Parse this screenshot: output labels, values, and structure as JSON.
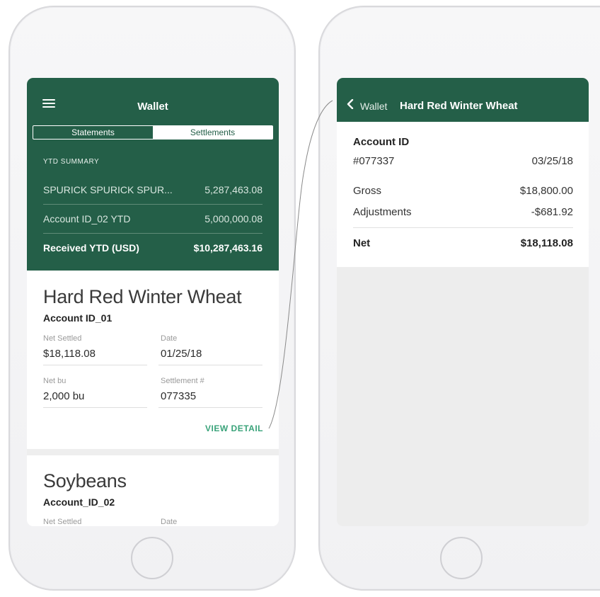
{
  "left_screen": {
    "header": {
      "title": "Wallet",
      "tabs": [
        {
          "label": "Statements",
          "active": false
        },
        {
          "label": "Settlements",
          "active": true
        }
      ]
    },
    "ytd_summary": {
      "label": "YTD SUMMARY",
      "rows": [
        {
          "label": "SPURICK SPURICK SPUR...",
          "value": "5,287,463.08"
        },
        {
          "label": "Account ID_02 YTD",
          "value": "5,000,000.08"
        }
      ],
      "total": {
        "label": "Received YTD (USD)",
        "value": "$10,287,463.16"
      }
    },
    "cards": [
      {
        "title": "Hard Red Winter Wheat",
        "account": "Account ID_01",
        "fields": [
          {
            "label": "Net Settled",
            "value": "$18,118.08"
          },
          {
            "label": "Date",
            "value": "01/25/18"
          },
          {
            "label": "Net bu",
            "value": "2,000 bu"
          },
          {
            "label": "Settlement #",
            "value": "077335"
          }
        ],
        "action": "VIEW DETAIL"
      },
      {
        "title": "Soybeans",
        "account": "Account_ID_02",
        "fields": [
          {
            "label": "Net Settled"
          },
          {
            "label": "Date"
          }
        ]
      }
    ]
  },
  "right_screen": {
    "header": {
      "back_label": "Wallet",
      "title": "Hard Red Winter Wheat"
    },
    "detail": {
      "account_label": "Account ID",
      "account_number": "#077337",
      "date": "03/25/18",
      "rows": [
        {
          "label": "Gross",
          "value": "$18,800.00"
        },
        {
          "label": "Adjustments",
          "value": "-$681.92"
        }
      ],
      "net": {
        "label": "Net",
        "value": "$18,118.08"
      }
    }
  },
  "colors": {
    "brand_green": "#245f48",
    "link_green": "#3aa37a"
  }
}
